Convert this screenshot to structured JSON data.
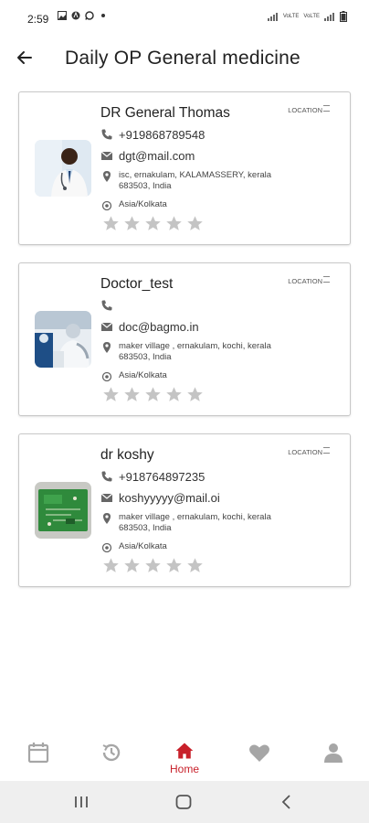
{
  "status_bar": {
    "time": "2:59",
    "signal_text_1": "VoLTE",
    "signal_text_2": "VoLTE"
  },
  "header": {
    "title": "Daily OP General medicine",
    "back_icon": "arrow-left-icon"
  },
  "doctors": [
    {
      "name": "DR General Thomas",
      "phone": "+919868789548",
      "email": "dgt@mail.com",
      "address": "isc, ernakulam, KALAMASSERY, kerala 683503, India",
      "timezone": "Asia/Kolkata",
      "location_label": "LOCATION",
      "rating": 0,
      "avatar": "doctor-photo"
    },
    {
      "name": "Doctor_test",
      "phone": "",
      "email": "doc@bagmo.in",
      "address": "maker village , ernakulam, kochi, kerala 683503, India",
      "timezone": "Asia/Kolkata",
      "location_label": "LOCATION",
      "rating": 0,
      "avatar": "medical-team-photo"
    },
    {
      "name": "dr koshy",
      "phone": "+918764897235",
      "email": "koshyyyyy@mail.oi",
      "address": "maker village , ernakulam, kochi, kerala 683503, India",
      "timezone": "Asia/Kolkata",
      "location_label": "LOCATION",
      "rating": 0,
      "avatar": "circuit-board-photo"
    }
  ],
  "bottom_nav": {
    "items": [
      {
        "icon": "calendar-icon",
        "label": ""
      },
      {
        "icon": "history-icon",
        "label": ""
      },
      {
        "icon": "home-icon",
        "label": "Home"
      },
      {
        "icon": "heart-icon",
        "label": ""
      },
      {
        "icon": "profile-icon",
        "label": ""
      }
    ]
  },
  "colors": {
    "accent": "#c8202a",
    "icon_gray": "#a6a6a6",
    "star_gray": "#c4c4c4",
    "card_border": "#c8c8c8"
  }
}
